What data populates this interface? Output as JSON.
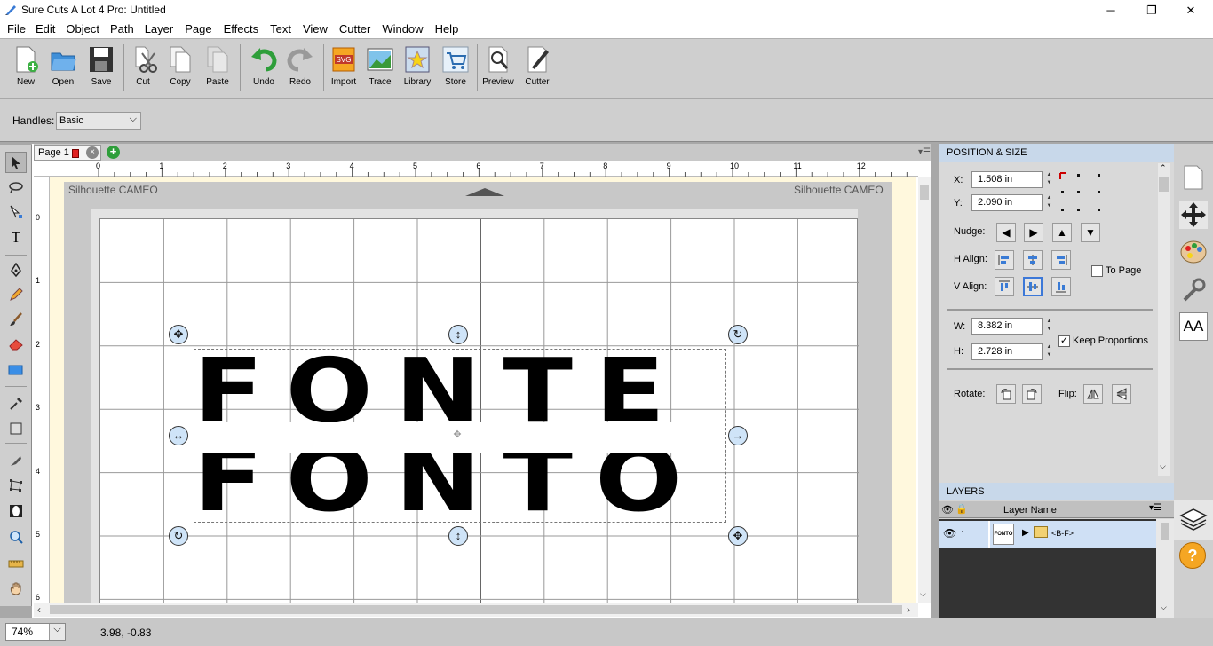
{
  "window": {
    "title": "Sure Cuts A Lot 4 Pro: Untitled",
    "minimize": "─",
    "maximize": "❐",
    "close": "✕"
  },
  "menu": [
    "File",
    "Edit",
    "Object",
    "Path",
    "Layer",
    "Page",
    "Effects",
    "Text",
    "View",
    "Cutter",
    "Window",
    "Help"
  ],
  "toolbar": {
    "new": "New",
    "open": "Open",
    "save": "Save",
    "cut": "Cut",
    "copy": "Copy",
    "paste": "Paste",
    "undo": "Undo",
    "redo": "Redo",
    "import": "Import",
    "trace": "Trace",
    "library": "Library",
    "store": "Store",
    "preview": "Preview",
    "cutter": "Cutter"
  },
  "handles": {
    "label": "Handles:",
    "value": "Basic"
  },
  "page_tab": {
    "label": "Page 1"
  },
  "ruler": {
    "top": [
      "0",
      "1",
      "2",
      "3",
      "4",
      "5",
      "6",
      "7",
      "8",
      "9",
      "10",
      "11",
      "12"
    ],
    "left": [
      "0",
      "1",
      "2",
      "3",
      "4",
      "5",
      "6"
    ]
  },
  "mat": {
    "left_label": "Silhouette CAMEO",
    "right_label": "Silhouette CAMEO"
  },
  "canvas_text": {
    "line1": "FONTE",
    "line2": "FONTO"
  },
  "status": {
    "zoom": "74%",
    "coords": "3.98, -0.83"
  },
  "position_size": {
    "header": "POSITION & SIZE",
    "x_label": "X:",
    "x_value": "1.508 in",
    "y_label": "Y:",
    "y_value": "2.090 in",
    "nudge_label": "Nudge:",
    "halign_label": "H Align:",
    "valign_label": "V Align:",
    "to_page": "To Page",
    "w_label": "W:",
    "w_value": "8.382 in",
    "h_label": "H:",
    "h_value": "2.728 in",
    "keep_proportions": "Keep Proportions",
    "rotate_label": "Rotate:",
    "flip_label": "Flip:"
  },
  "layers": {
    "header": "LAYERS",
    "column": "Layer Name",
    "thumb": "FONTO",
    "row_name": "<B-F>"
  },
  "colors": {
    "accent": "#3c78d8",
    "panel_head": "#c8d8ea",
    "mat": "#fff8dd",
    "selected_row": "#cfe0f5"
  }
}
